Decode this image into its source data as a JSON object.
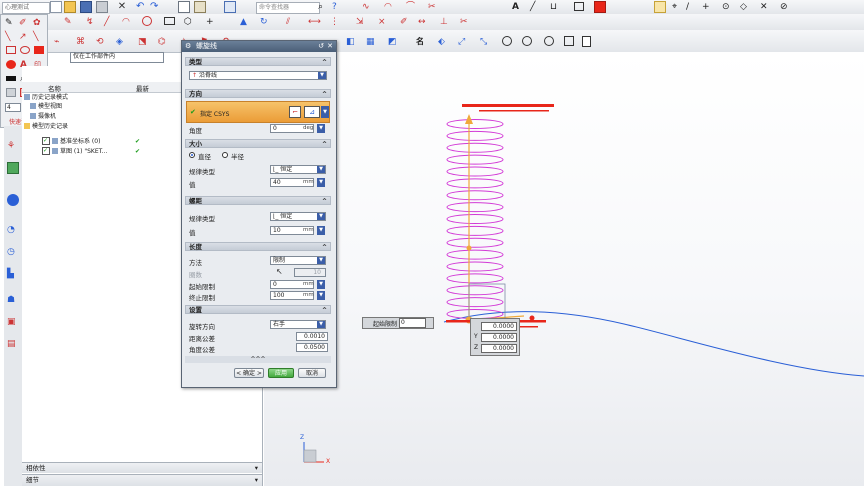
{
  "toolbar": {
    "menu_select": "仅在工作部件内",
    "search_placeholder": "命令查找器"
  },
  "left_palette": {
    "width_value": "4",
    "caption": "快速设计"
  },
  "nav": {
    "header_name": "名称",
    "header_latest": "最新",
    "items": [
      {
        "label": "历史记录模式",
        "check": ""
      },
      {
        "label": "模型视图",
        "check": ""
      },
      {
        "label": "摄像机",
        "check": ""
      },
      {
        "label": "模型历史记录",
        "check": ""
      },
      {
        "label": "基准坐标系 (0)",
        "check": "✔"
      },
      {
        "label": "草图 (1) \"SKET...",
        "check": "✔"
      }
    ],
    "footer_dependencies": "相依性",
    "footer_details": "细节"
  },
  "dialog": {
    "title": "螺旋线",
    "sec_type": "类型",
    "type_value": "沿脊线",
    "sec_direction": "方向",
    "csys_label": "指定 CSYS",
    "angle_label": "角度",
    "angle_value": "0",
    "angle_unit": "deg",
    "sec_size": "大小",
    "radio_diameter": "直径",
    "radio_radius": "半径",
    "size_law_label": "规律类型",
    "size_law_value": "恒定",
    "size_value_label": "值",
    "size_value": "40",
    "size_unit": "mm",
    "sec_pitch": "螺距",
    "pitch_law_label": "规律类型",
    "pitch_law_value": "恒定",
    "pitch_value_label": "值",
    "pitch_value": "10",
    "pitch_unit": "mm",
    "sec_length": "长度",
    "method_label": "方法",
    "method_value": "限制",
    "turns_label": "圈数",
    "turns_value": "10",
    "start_label": "起始限制",
    "start_value": "0",
    "start_unit": "mm",
    "end_label": "终止限制",
    "end_value": "100",
    "end_unit": "mm",
    "sec_settings": "设置",
    "rotation_label": "旋转方向",
    "rotation_value": "右手",
    "dist_tol_label": "距离公差",
    "dist_tol_value": "0.0010",
    "angle_tol_label": "角度公差",
    "angle_tol_value": "0.0500",
    "ok": "< 确定 >",
    "apply": "应用",
    "cancel": "取消"
  },
  "viewport": {
    "start_limit_label": "起始限制",
    "start_limit_value": "0",
    "coord_x": "0.0000",
    "coord_y": "0.0000",
    "coord_z": "0.0000",
    "axis_x": "X",
    "axis_y": "Y",
    "axis_z": "Z"
  },
  "colors": {
    "helix": "#d23ad6",
    "curve": "#2a5fd6",
    "highlight": "#e8261a",
    "accent": "#f0a93a"
  }
}
